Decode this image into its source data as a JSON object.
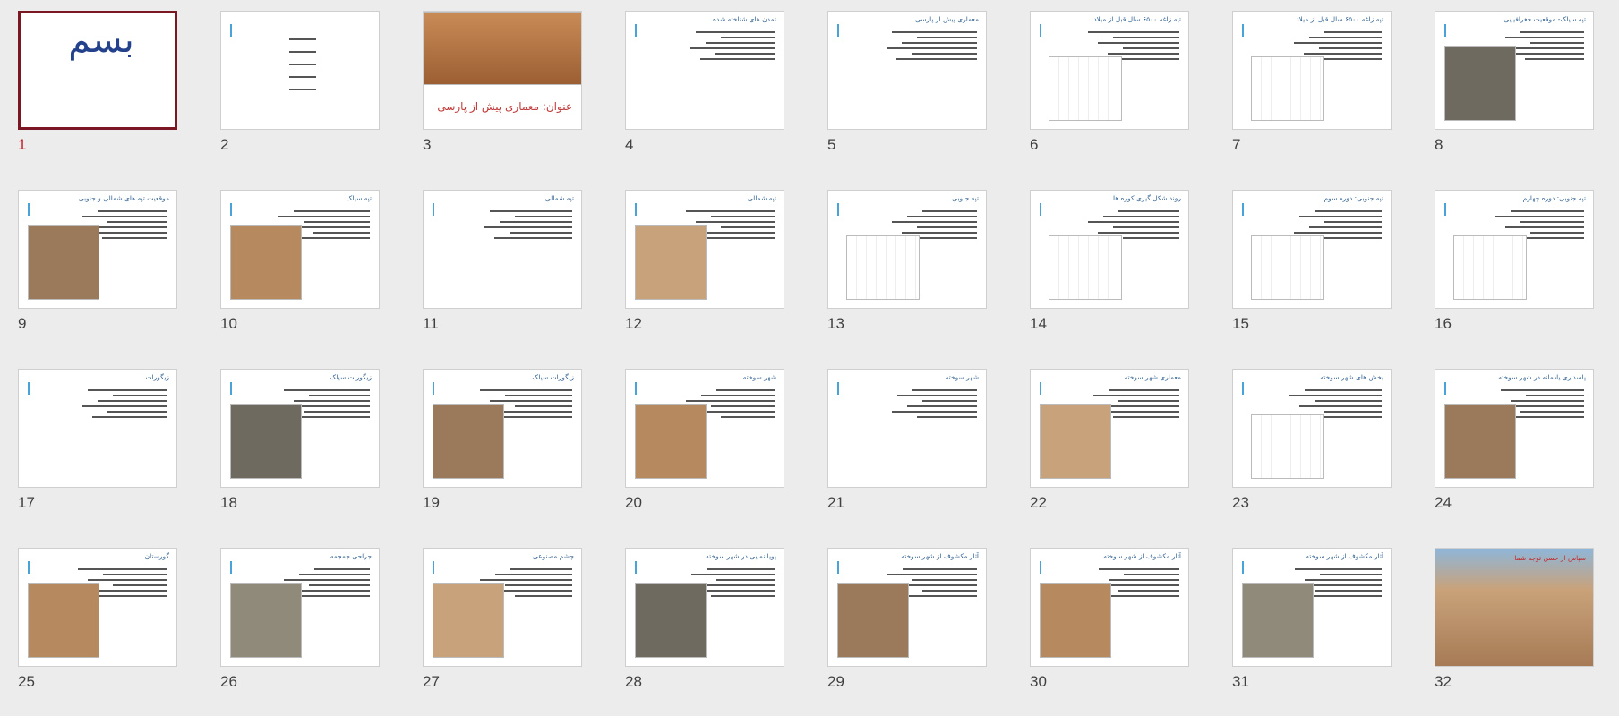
{
  "slides": [
    {
      "n": "1",
      "title": "",
      "selected": true
    },
    {
      "n": "2",
      "title": ""
    },
    {
      "n": "3",
      "title": "عنوان: معماری پیش از پارسی"
    },
    {
      "n": "4",
      "title": "تمدن های شناخته شده"
    },
    {
      "n": "5",
      "title": "معماری پیش از پارسی"
    },
    {
      "n": "6",
      "title": "تپه زاغه ۶۵۰۰ سال قبل از میلاد"
    },
    {
      "n": "7",
      "title": "تپه زاغه ۶۵۰۰ سال قبل از میلاد"
    },
    {
      "n": "8",
      "title": "تپه سیلک- موقعیت جغرافیایی"
    },
    {
      "n": "9",
      "title": "موقعیت تپه های شمالی و جنوبی"
    },
    {
      "n": "10",
      "title": "تپه سیلک"
    },
    {
      "n": "11",
      "title": "تپه شمالی"
    },
    {
      "n": "12",
      "title": "تپه شمالی"
    },
    {
      "n": "13",
      "title": "تپه جنوبی"
    },
    {
      "n": "14",
      "title": "روند شکل گیری کوره ها"
    },
    {
      "n": "15",
      "title": "تپه جنوبی: دوره سوم"
    },
    {
      "n": "16",
      "title": "تپه جنوبی: دوره چهارم"
    },
    {
      "n": "17",
      "title": "زیگورات"
    },
    {
      "n": "18",
      "title": "زیگورات سیلک"
    },
    {
      "n": "19",
      "title": "زیگورات سیلک"
    },
    {
      "n": "20",
      "title": "شهر سوخته"
    },
    {
      "n": "21",
      "title": "شهر سوخته"
    },
    {
      "n": "22",
      "title": "معماری شهر سوخته"
    },
    {
      "n": "23",
      "title": "بخش های شهر سوخته"
    },
    {
      "n": "24",
      "title": "پاسداری یادمانه در شهر سوخته"
    },
    {
      "n": "25",
      "title": "گورستان"
    },
    {
      "n": "26",
      "title": "جراحی جمجمه"
    },
    {
      "n": "27",
      "title": "چشم مصنوعی"
    },
    {
      "n": "28",
      "title": "پویا نمایی در شهر سوخته"
    },
    {
      "n": "29",
      "title": "آثار مکشوف از شهر سوخته"
    },
    {
      "n": "30",
      "title": "آثار مکشوف از شهر سوخته"
    },
    {
      "n": "31",
      "title": "آثار مکشوف از شهر سوخته"
    },
    {
      "n": "32",
      "title": "سپاس از حسن توجه شما"
    }
  ],
  "colors": {
    "selected_border": "#7a1722",
    "selected_number": "#c1272d",
    "title_text": "#2f5f8f"
  }
}
